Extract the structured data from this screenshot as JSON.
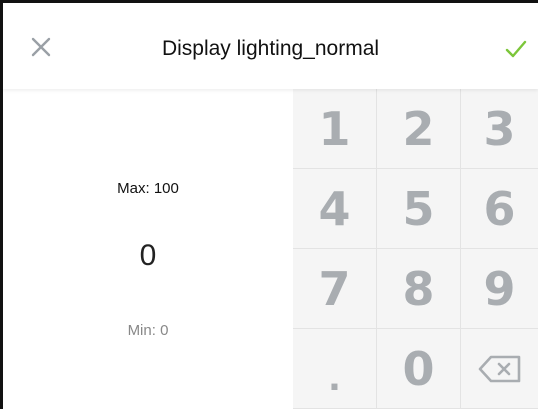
{
  "dialog": {
    "title": "Display lighting_normal",
    "close_icon": "close-icon",
    "confirm_icon": "checkmark-icon"
  },
  "value_panel": {
    "max_label": "Max: 100",
    "current_value": "0",
    "min_label": "Min: 0"
  },
  "keypad": {
    "keys": [
      "1",
      "2",
      "3",
      "4",
      "5",
      "6",
      "7",
      "8",
      "9",
      ".",
      "0"
    ],
    "backspace_icon": "backspace-icon"
  },
  "colors": {
    "checkmark": "#7cc63a",
    "close": "#9aa0a6",
    "key_text": "#a9adb1",
    "keypad_bg": "#f5f5f5"
  }
}
